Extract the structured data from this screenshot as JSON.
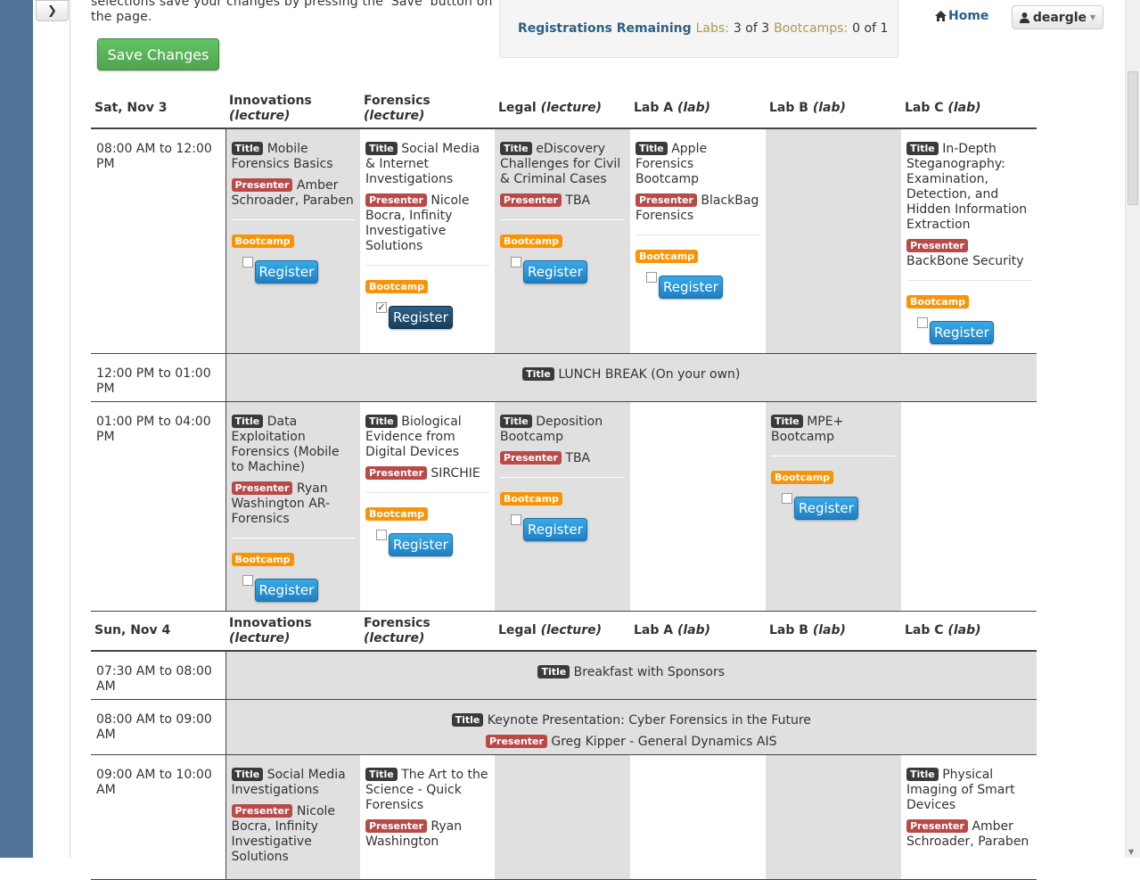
{
  "nav": {
    "toggle_icon": "chevron-right-icon",
    "home_label": "Home",
    "user_label": "deargle"
  },
  "intro_text": "selections save your changes by pressing the 'Save' button on the page.",
  "save_label": "Save Changes",
  "registrations": {
    "heading": "Registrations Remaining",
    "labs_label": "Labs:",
    "labs_value": "3 of 3",
    "bootcamps_label": "Bootcamps:",
    "bootcamps_value": "0 of 1"
  },
  "badges": {
    "title": "Title",
    "presenter": "Presenter",
    "bootcamp": "Bootcamp",
    "register": "Register"
  },
  "days": [
    {
      "date": "Sat, Nov 3",
      "tracks": [
        {
          "name": "Innovations",
          "type": "(lecture)"
        },
        {
          "name": "Forensics",
          "type": "(lecture)"
        },
        {
          "name": "Legal",
          "type": "(lecture)"
        },
        {
          "name": "Lab A",
          "type": "(lab)"
        },
        {
          "name": "Lab B",
          "type": "(lab)"
        },
        {
          "name": "Lab C",
          "type": "(lab)"
        }
      ],
      "slots": [
        {
          "time": "08:00 AM to 12:00 PM",
          "sessions": [
            {
              "title": "Mobile Forensics Basics",
              "presenter": "Amber Schroader, Paraben",
              "checked": false
            },
            {
              "title": "Social Media & Internet Investigations",
              "presenter": "Nicole Bocra, Infinity Investigative Solutions",
              "checked": true
            },
            {
              "title": "eDiscovery Challenges for Civil & Criminal Cases",
              "presenter": "TBA",
              "checked": false
            },
            {
              "title": "Apple Forensics Bootcamp",
              "presenter": "BlackBag Forensics",
              "checked": false
            },
            null,
            {
              "title": "In-Depth Steganography: Examination, Detection, and Hidden Information Extraction",
              "presenter": "BackBone Security",
              "checked": false
            }
          ]
        },
        {
          "time": "12:00 PM to 01:00 PM",
          "full_title": "LUNCH BREAK (On your own)"
        },
        {
          "time": "01:00 PM to 04:00 PM",
          "sessions": [
            {
              "title": "Data Exploitation Forensics (Mobile to Machine)",
              "presenter": "Ryan Washington AR-Forensics",
              "checked": false
            },
            {
              "title": "Biological Evidence from Digital Devices",
              "presenter": "SIRCHIE",
              "checked": false
            },
            {
              "title": "Deposition Bootcamp",
              "presenter": "TBA",
              "checked": false
            },
            null,
            {
              "title": "MPE+ Bootcamp",
              "presenter": null,
              "checked": false
            },
            null
          ]
        }
      ]
    },
    {
      "date": "Sun, Nov 4",
      "tracks": [
        {
          "name": "Innovations",
          "type": "(lecture)"
        },
        {
          "name": "Forensics",
          "type": "(lecture)"
        },
        {
          "name": "Legal",
          "type": "(lecture)"
        },
        {
          "name": "Lab A",
          "type": "(lab)"
        },
        {
          "name": "Lab B",
          "type": "(lab)"
        },
        {
          "name": "Lab C",
          "type": "(lab)"
        }
      ],
      "slots": [
        {
          "time": "07:30 AM to 08:00 AM",
          "full_title": "Breakfast with Sponsors"
        },
        {
          "time": "08:00 AM to 09:00 AM",
          "full_title": "Keynote Presentation: Cyber Forensics in the Future",
          "full_presenter": "Greg Kipper - General Dynamics AIS"
        },
        {
          "time": "09:00 AM to 10:00 AM",
          "sessions": [
            {
              "title": "Social Media Investigations",
              "presenter": "Nicole Bocra, Infinity Investigative Solutions"
            },
            {
              "title": "The Art to the Science - Quick Forensics",
              "presenter": "Ryan Washington"
            },
            null,
            null,
            null,
            {
              "title": "Physical Imaging of Smart Devices",
              "presenter": "Amber Schroader, Paraben"
            }
          ]
        }
      ]
    }
  ]
}
